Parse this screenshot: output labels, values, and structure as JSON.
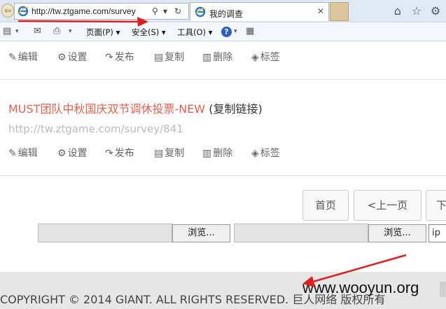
{
  "browser": {
    "back_glyph": "⇦",
    "url": "http://tw.ztgame.com/survey",
    "search_glyph": "⚲",
    "dropdown_glyph": "▾",
    "refresh_glyph": "↻",
    "tab_title": "我的调查",
    "tab_close_glyph": "✕",
    "home_glyph": "⌂",
    "star_glyph": "☆",
    "gear_glyph": "⚙"
  },
  "command_bar": {
    "rss_glyph": "▤",
    "mail_glyph": "✉",
    "print_glyph": "⎙",
    "page_label": "页面(P) ▾",
    "safety_label": "安全(S) ▾",
    "tools_label": "工具(O) ▾",
    "help_glyph": "?",
    "extra_glyph": "▾"
  },
  "actions": {
    "edit": "编辑",
    "settings": "设置",
    "publish": "发布",
    "copy": "复制",
    "delete": "删除",
    "tag": "标签",
    "icons": {
      "edit": "✎",
      "settings": "⚙",
      "publish": "↷",
      "copy": "▤",
      "delete": "▥",
      "tag": "◈"
    }
  },
  "survey": {
    "title": "MUST团队中秋国庆双节调休投票-NEW",
    "copy_link": " (复制链接)",
    "url": "http://tw.ztgame.com/survey/841"
  },
  "pagination": {
    "first": "首页",
    "prev": "<上一页",
    "next": "下"
  },
  "upload": {
    "browse_1": "浏览...",
    "browse_2": "浏览...",
    "ip_value": "ip"
  },
  "footer": {
    "copyright": "COPYRIGHT © 2014 GIANT. ALL RIGHTS RESERVED. 巨人网络 版权所有",
    "watermark": "www.wooyun.org"
  },
  "colors": {
    "title_red": "#e8604c",
    "arrow_red": "#e02020"
  }
}
